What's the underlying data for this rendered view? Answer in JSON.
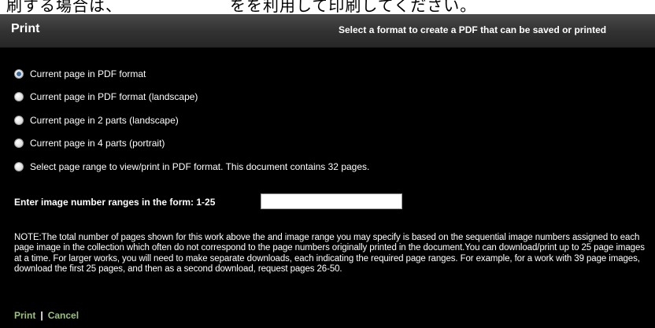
{
  "page_header_fragment": "刷する場合は、　　　　　　　をを利用して印刷してください。",
  "dialog": {
    "title": "Print",
    "description": "Select a format to create a PDF that can be saved or printed"
  },
  "options": [
    {
      "label": "Current page in PDF format",
      "checked": true
    },
    {
      "label": "Current page in PDF format (landscape)",
      "checked": false
    },
    {
      "label": "Current page in 2 parts (landscape)",
      "checked": false
    },
    {
      "label": "Current page in 4 parts (portrait)",
      "checked": false
    },
    {
      "label": "Select page range to view/print in PDF format. This document contains 32 pages.",
      "checked": false
    }
  ],
  "range": {
    "label": "Enter image number ranges in the form: 1-25",
    "value": ""
  },
  "note": "NOTE:The total number of pages shown for this work above the and image range you may specify is based on the sequential image numbers assigned to each page image in the collection which often do not correspond to the page numbers originally printed in the document.You can download/print up to 25 page images at a time. For larger works, you will need to make separate downloads, each indicating the required page ranges. For example, for a work with 39 page images, download the first 25 pages, and then as a second download, request pages 26-50.",
  "footer": {
    "print_label": "Print",
    "separator": "|",
    "cancel_label": "Cancel"
  },
  "colors": {
    "background": "#000000",
    "link": "#9bc27c",
    "radio_checked": "#3a6ea5"
  }
}
